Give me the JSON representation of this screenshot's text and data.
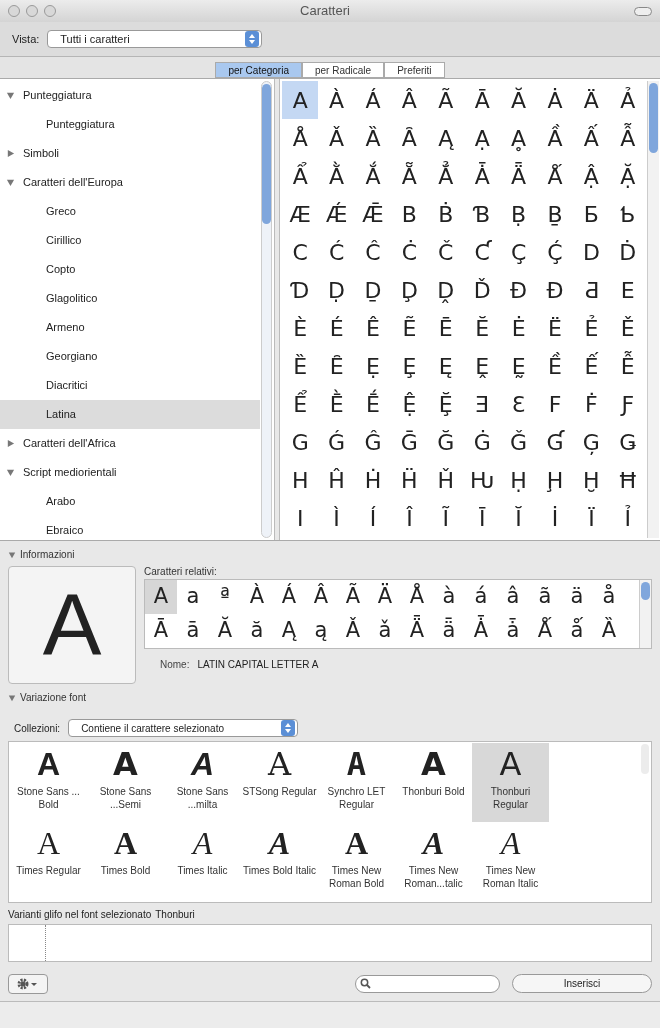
{
  "window": {
    "title": "Caratteri"
  },
  "toolbar": {
    "view_label": "Vista:",
    "view_value": "Tutti i caratteri"
  },
  "tabs": [
    {
      "label": "per Categoria",
      "selected": true
    },
    {
      "label": "per Radicale",
      "selected": false
    },
    {
      "label": "Preferiti",
      "selected": false
    }
  ],
  "sidebar": {
    "items": [
      {
        "label": "Punteggiatura",
        "expanded": true,
        "selected": false,
        "children": [
          {
            "label": "Punteggiatura",
            "selected": false
          }
        ]
      },
      {
        "label": "Simboli",
        "expanded": false,
        "selected": false
      },
      {
        "label": "Caratteri dell'Europa",
        "expanded": true,
        "selected": false,
        "children": [
          {
            "label": "Greco",
            "selected": false
          },
          {
            "label": "Cirillico",
            "selected": false
          },
          {
            "label": "Copto",
            "selected": false
          },
          {
            "label": "Glagolitico",
            "selected": false
          },
          {
            "label": "Armeno",
            "selected": false
          },
          {
            "label": "Georgiano",
            "selected": false
          },
          {
            "label": "Diacritici",
            "selected": false
          },
          {
            "label": "Latina",
            "selected": true
          }
        ]
      },
      {
        "label": "Caratteri dell'Africa",
        "expanded": false,
        "selected": false
      },
      {
        "label": "Script mediorientali",
        "expanded": true,
        "selected": false,
        "children": [
          {
            "label": "Arabo",
            "selected": false
          },
          {
            "label": "Ebraico",
            "selected": false
          }
        ]
      }
    ]
  },
  "characters": {
    "rows": [
      [
        {
          "char": "A",
          "selected": true
        },
        {
          "char": "À",
          "selected": false
        },
        {
          "char": "Á",
          "selected": false
        },
        {
          "char": "Â",
          "selected": false
        },
        {
          "char": "Ã",
          "selected": false
        },
        {
          "char": "Ā",
          "selected": false
        },
        {
          "char": "Ă",
          "selected": false
        },
        {
          "char": "Ȧ",
          "selected": false
        },
        {
          "char": "Ä",
          "selected": false
        },
        {
          "char": "Ả",
          "selected": false
        }
      ],
      [
        {
          "char": "Å",
          "selected": false
        },
        {
          "char": "Ǎ",
          "selected": false
        },
        {
          "char": "Ȁ",
          "selected": false
        },
        {
          "char": "Ȃ",
          "selected": false
        },
        {
          "char": "Ą",
          "selected": false
        },
        {
          "char": "Ạ",
          "selected": false
        },
        {
          "char": "Ḁ",
          "selected": false
        },
        {
          "char": "Ầ",
          "selected": false
        },
        {
          "char": "Ấ",
          "selected": false
        },
        {
          "char": "Ẫ",
          "selected": false
        }
      ],
      [
        {
          "char": "Ẩ",
          "selected": false
        },
        {
          "char": "Ằ",
          "selected": false
        },
        {
          "char": "Ắ",
          "selected": false
        },
        {
          "char": "Ẵ",
          "selected": false
        },
        {
          "char": "Ẳ",
          "selected": false
        },
        {
          "char": "Ǡ",
          "selected": false
        },
        {
          "char": "Ǟ",
          "selected": false
        },
        {
          "char": "Ǻ",
          "selected": false
        },
        {
          "char": "Ậ",
          "selected": false
        },
        {
          "char": "Ặ",
          "selected": false
        }
      ],
      [
        {
          "char": "Æ",
          "selected": false
        },
        {
          "char": "Ǽ",
          "selected": false
        },
        {
          "char": "Ǣ",
          "selected": false
        },
        {
          "char": "B",
          "selected": false
        },
        {
          "char": "Ḃ",
          "selected": false
        },
        {
          "char": "Ɓ",
          "selected": false
        },
        {
          "char": "Ḅ",
          "selected": false
        },
        {
          "char": "Ḇ",
          "selected": false
        },
        {
          "char": "Ƃ",
          "selected": false
        },
        {
          "char": "Ƅ",
          "selected": false
        }
      ],
      [
        {
          "char": "C",
          "selected": false
        },
        {
          "char": "Ć",
          "selected": false
        },
        {
          "char": "Ĉ",
          "selected": false
        },
        {
          "char": "Ċ",
          "selected": false
        },
        {
          "char": "Č",
          "selected": false
        },
        {
          "char": "Ƈ",
          "selected": false
        },
        {
          "char": "Ç",
          "selected": false
        },
        {
          "char": "Ḉ",
          "selected": false
        },
        {
          "char": "D",
          "selected": false
        },
        {
          "char": "Ḋ",
          "selected": false
        }
      ],
      [
        {
          "char": "Ɗ",
          "selected": false
        },
        {
          "char": "Ḍ",
          "selected": false
        },
        {
          "char": "Ḏ",
          "selected": false
        },
        {
          "char": "Ḑ",
          "selected": false
        },
        {
          "char": "Ḓ",
          "selected": false
        },
        {
          "char": "Ď",
          "selected": false
        },
        {
          "char": "Đ",
          "selected": false
        },
        {
          "char": "Ɖ",
          "selected": false
        },
        {
          "char": "Ƌ",
          "selected": false
        },
        {
          "char": "E",
          "selected": false
        }
      ],
      [
        {
          "char": "È",
          "selected": false
        },
        {
          "char": "É",
          "selected": false
        },
        {
          "char": "Ê",
          "selected": false
        },
        {
          "char": "Ẽ",
          "selected": false
        },
        {
          "char": "Ē",
          "selected": false
        },
        {
          "char": "Ĕ",
          "selected": false
        },
        {
          "char": "Ė",
          "selected": false
        },
        {
          "char": "Ë",
          "selected": false
        },
        {
          "char": "Ẻ",
          "selected": false
        },
        {
          "char": "Ě",
          "selected": false
        }
      ],
      [
        {
          "char": "Ȅ",
          "selected": false
        },
        {
          "char": "Ȇ",
          "selected": false
        },
        {
          "char": "Ẹ",
          "selected": false
        },
        {
          "char": "Ȩ",
          "selected": false
        },
        {
          "char": "Ę",
          "selected": false
        },
        {
          "char": "Ḙ",
          "selected": false
        },
        {
          "char": "Ḛ",
          "selected": false
        },
        {
          "char": "Ề",
          "selected": false
        },
        {
          "char": "Ế",
          "selected": false
        },
        {
          "char": "Ễ",
          "selected": false
        }
      ],
      [
        {
          "char": "Ể",
          "selected": false
        },
        {
          "char": "Ḕ",
          "selected": false
        },
        {
          "char": "Ḗ",
          "selected": false
        },
        {
          "char": "Ệ",
          "selected": false
        },
        {
          "char": "Ḝ",
          "selected": false
        },
        {
          "char": "Ǝ",
          "selected": false
        },
        {
          "char": "Ɛ",
          "selected": false
        },
        {
          "char": "F",
          "selected": false
        },
        {
          "char": "Ḟ",
          "selected": false
        },
        {
          "char": "Ƒ",
          "selected": false
        }
      ],
      [
        {
          "char": "G",
          "selected": false
        },
        {
          "char": "Ǵ",
          "selected": false
        },
        {
          "char": "Ĝ",
          "selected": false
        },
        {
          "char": "Ḡ",
          "selected": false
        },
        {
          "char": "Ğ",
          "selected": false
        },
        {
          "char": "Ġ",
          "selected": false
        },
        {
          "char": "Ǧ",
          "selected": false
        },
        {
          "char": "Ɠ",
          "selected": false
        },
        {
          "char": "Ģ",
          "selected": false
        },
        {
          "char": "Ǥ",
          "selected": false
        }
      ],
      [
        {
          "char": "H",
          "selected": false
        },
        {
          "char": "Ĥ",
          "selected": false
        },
        {
          "char": "Ḣ",
          "selected": false
        },
        {
          "char": "Ḧ",
          "selected": false
        },
        {
          "char": "Ȟ",
          "selected": false
        },
        {
          "char": "Ƕ",
          "selected": false
        },
        {
          "char": "Ḥ",
          "selected": false
        },
        {
          "char": "Ḩ",
          "selected": false
        },
        {
          "char": "Ḫ",
          "selected": false
        },
        {
          "char": "Ħ",
          "selected": false
        }
      ],
      [
        {
          "char": "I",
          "selected": false
        },
        {
          "char": "Ì",
          "selected": false
        },
        {
          "char": "Í",
          "selected": false
        },
        {
          "char": "Î",
          "selected": false
        },
        {
          "char": "Ĩ",
          "selected": false
        },
        {
          "char": "Ī",
          "selected": false
        },
        {
          "char": "Ĭ",
          "selected": false
        },
        {
          "char": "İ",
          "selected": false
        },
        {
          "char": "Ï",
          "selected": false
        },
        {
          "char": "Ỉ",
          "selected": false
        }
      ]
    ]
  },
  "info": {
    "heading": "Informazioni",
    "expanded": true,
    "preview": "A",
    "related_label": "Caratteri relativi:",
    "related_rows": [
      [
        {
          "char": "A",
          "selected": true
        },
        {
          "char": "a",
          "selected": false
        },
        {
          "char": "ª",
          "selected": false
        },
        {
          "char": "À",
          "selected": false
        },
        {
          "char": "Á",
          "selected": false
        },
        {
          "char": "Â",
          "selected": false
        },
        {
          "char": "Ã",
          "selected": false
        },
        {
          "char": "Ä",
          "selected": false
        },
        {
          "char": "Å",
          "selected": false
        },
        {
          "char": "à",
          "selected": false
        },
        {
          "char": "á",
          "selected": false
        },
        {
          "char": "â",
          "selected": false
        },
        {
          "char": "ã",
          "selected": false
        },
        {
          "char": "ä",
          "selected": false
        },
        {
          "char": "å",
          "selected": false
        }
      ],
      [
        {
          "char": "Ā",
          "selected": false
        },
        {
          "char": "ā",
          "selected": false
        },
        {
          "char": "Ă",
          "selected": false
        },
        {
          "char": "ă",
          "selected": false
        },
        {
          "char": "Ą",
          "selected": false
        },
        {
          "char": "ą",
          "selected": false
        },
        {
          "char": "Ǎ",
          "selected": false
        },
        {
          "char": "ǎ",
          "selected": false
        },
        {
          "char": "Ǟ",
          "selected": false
        },
        {
          "char": "ǟ",
          "selected": false
        },
        {
          "char": "Ǡ",
          "selected": false
        },
        {
          "char": "ǡ",
          "selected": false
        },
        {
          "char": "Ǻ",
          "selected": false
        },
        {
          "char": "ǻ",
          "selected": false
        },
        {
          "char": "Ȁ",
          "selected": false
        }
      ]
    ],
    "name_label": "Nome:",
    "name_value": "LATIN CAPITAL LETTER A"
  },
  "font_variation": {
    "heading": "Variazione font",
    "expanded": true,
    "collections_label": "Collezioni:",
    "collections_value": "Contiene il carattere selezionato",
    "fonts": [
      {
        "glyph": "A",
        "kind": "blackSans",
        "name": "Stone Sans ... Bold",
        "selected": false
      },
      {
        "glyph": "A",
        "kind": "boldSans",
        "name": "Stone Sans ...Semi",
        "selected": false
      },
      {
        "glyph": "A",
        "kind": "obliqueSans",
        "name": "Stone Sans ...milta",
        "selected": false
      },
      {
        "glyph": "A",
        "kind": "lightSerif",
        "name": "STSong Regular",
        "selected": false
      },
      {
        "glyph": "A",
        "kind": "stencil",
        "name": "Synchro LET Regular",
        "selected": false
      },
      {
        "glyph": "A",
        "kind": "boldSans",
        "name": "Thonburi Bold",
        "selected": false
      },
      {
        "glyph": "A",
        "kind": "plainSans",
        "name": "Thonburi Regular",
        "selected": true
      },
      {
        "glyph": "A",
        "kind": "plainSerif",
        "name": "Times Regular",
        "selected": false
      },
      {
        "glyph": "A",
        "kind": "boldSerif",
        "name": "Times Bold",
        "selected": false
      },
      {
        "glyph": "A",
        "kind": "italicSerif",
        "name": "Times Italic",
        "selected": false
      },
      {
        "glyph": "A",
        "kind": "boldItalicSerif",
        "name": "Times Bold Italic",
        "selected": false
      },
      {
        "glyph": "A",
        "kind": "boldSerif",
        "name": "Times New Roman Bold",
        "selected": false
      },
      {
        "glyph": "A",
        "kind": "boldItalicSerif",
        "name": "Times New Roman...talic",
        "selected": false
      },
      {
        "glyph": "A",
        "kind": "italicSerif",
        "name": "Times New Roman Italic",
        "selected": false
      }
    ],
    "variants_label": "Varianti glifo nel font selezionato",
    "variants_font": "Thonburi"
  },
  "bottom_bar": {
    "button": "Inserisci"
  }
}
